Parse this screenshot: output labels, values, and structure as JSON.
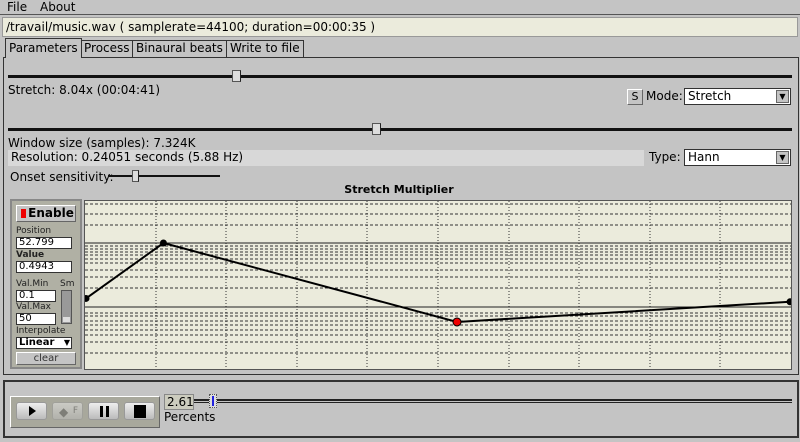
{
  "menu": {
    "file": "File",
    "about": "About"
  },
  "file_info": "/travail/music.wav ( samplerate=44100; duration=00:00:35 )",
  "tabs": [
    "Parameters",
    "Process",
    "Binaural beats",
    "Write to file"
  ],
  "stretch": {
    "label": "Stretch: 8.04x (00:04:41)",
    "s_button": "S",
    "mode_label": "Mode:",
    "mode_value": "Stretch"
  },
  "window": {
    "label": "Window size (samples): 7.324K",
    "resolution": "Resolution: 0.24051 seconds (5.88 Hz)",
    "type_label": "Type:",
    "type_value": "Hann"
  },
  "onset": {
    "label": "Onset sensitivity:"
  },
  "graph": {
    "title": "Stretch Multiplier",
    "points": [
      [
        0,
        0.58
      ],
      [
        0.11,
        0.25
      ],
      [
        0.527,
        0.72
      ],
      [
        1,
        0.6
      ]
    ],
    "selected": 2
  },
  "side": {
    "enable": "Enable",
    "position_label": "Position",
    "position": "52.799",
    "value_label": "Value",
    "value": "0.4943",
    "valmin_label": "Val.Min",
    "valmin": "0.1",
    "sm_label": "Sm",
    "valmax_label": "Val.Max",
    "valmax": "50",
    "interp_label": "Interpolate",
    "interp": "Linear",
    "clear": "clear"
  },
  "player": {
    "percent_value": "2.61",
    "percent_label": "Percents",
    "fwd_label": "F"
  }
}
